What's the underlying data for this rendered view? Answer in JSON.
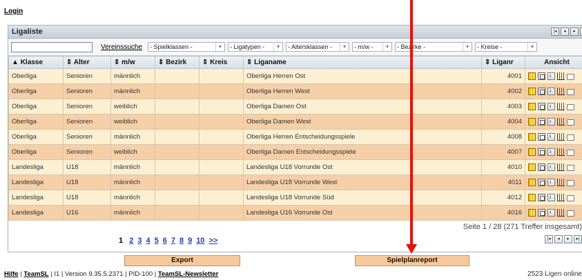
{
  "login": "Login",
  "panel": {
    "title": "Ligaliste"
  },
  "filters": {
    "search_value": "",
    "vereinssuche": "Vereinssuche",
    "spielklassen": "- Spielklassen -",
    "ligatypen": "- Ligatypen -",
    "altersklassen": "- Altersklassen -",
    "mw": "- m/w -",
    "bezirke": "- Bezirke -",
    "kreise": "- Kreise -"
  },
  "columns": {
    "klasse": "Klasse",
    "alter": "Alter",
    "mw": "m/w",
    "bezirk": "Bezirk",
    "kreis": "Kreis",
    "liganame": "Liganame",
    "liganr": "Liganr",
    "ansicht": "Ansicht"
  },
  "rows": [
    {
      "klasse": "Oberliga",
      "alter": "Senioren",
      "mw": "männlich",
      "bezirk": "",
      "kreis": "",
      "liganame": "Oberliga Herren Ost",
      "liganr": "4001"
    },
    {
      "klasse": "Oberliga",
      "alter": "Senioren",
      "mw": "männlich",
      "bezirk": "",
      "kreis": "",
      "liganame": "Oberliga Herren West",
      "liganr": "4002"
    },
    {
      "klasse": "Oberliga",
      "alter": "Senioren",
      "mw": "weiblich",
      "bezirk": "",
      "kreis": "",
      "liganame": "Oberliga Damen Ost",
      "liganr": "4003"
    },
    {
      "klasse": "Oberliga",
      "alter": "Senioren",
      "mw": "weiblich",
      "bezirk": "",
      "kreis": "",
      "liganame": "Oberliga Damen West",
      "liganr": "4004"
    },
    {
      "klasse": "Oberliga",
      "alter": "Senioren",
      "mw": "männlich",
      "bezirk": "",
      "kreis": "",
      "liganame": "Oberliga Herren Entscheidungsspiele",
      "liganr": "4008"
    },
    {
      "klasse": "Oberliga",
      "alter": "Senioren",
      "mw": "weiblich",
      "bezirk": "",
      "kreis": "",
      "liganame": "Oberliga Damen Entscheidungsspiele",
      "liganr": "4007"
    },
    {
      "klasse": "Landesliga",
      "alter": "U18",
      "mw": "männlich",
      "bezirk": "",
      "kreis": "",
      "liganame": "Landesliga U18 Vorrunde Ost",
      "liganr": "4010"
    },
    {
      "klasse": "Landesliga",
      "alter": "U18",
      "mw": "männlich",
      "bezirk": "",
      "kreis": "",
      "liganame": "Landesliga U18 Vorrunde West",
      "liganr": "4011"
    },
    {
      "klasse": "Landesliga",
      "alter": "U18",
      "mw": "männlich",
      "bezirk": "",
      "kreis": "",
      "liganame": "Landesliga U18 Vorrunde Süd",
      "liganr": "4012"
    },
    {
      "klasse": "Landesliga",
      "alter": "U16",
      "mw": "männlich",
      "bezirk": "",
      "kreis": "",
      "liganame": "Landesliga U16 Vorrunde Ost",
      "liganr": "4016"
    }
  ],
  "row_icons": [
    "table-icon",
    "clipboard-icon",
    "document-icon",
    "chart-icon",
    "print-icon"
  ],
  "summary": "Seite 1 / 28 (271 Treffer insgesamt)",
  "pages": {
    "current": "1",
    "links": [
      "2",
      "3",
      "4",
      "5",
      "6",
      "7",
      "8",
      "9",
      "10",
      ">>"
    ]
  },
  "buttons": {
    "export": "Export",
    "spielplanreport": "Spielplanreport"
  },
  "status": {
    "hilfe": "Hilfe",
    "teamsl": "TeamSL",
    "version": "| I1 | Version 9.35.5.2371 | PID-100 |",
    "newsletter": "TeamSL-Newsletter",
    "ligen": "2523 Ligen online"
  },
  "colors": {
    "row_odd": "#fdf0d2",
    "row_even": "#f5cfa8",
    "annotation_arrow": "#e5120a"
  }
}
